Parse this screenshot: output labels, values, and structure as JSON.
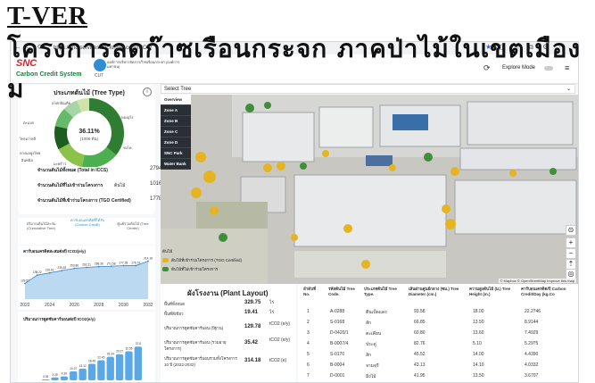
{
  "heading": {
    "title": "T-VER",
    "subtitle_line1": "โครงการลดก๊าซเรือนกระจก ภาคป่าไม้ในเขตเมือง",
    "subtitle_line2": "ม"
  },
  "browser": {
    "url": "https://snc-services.sncformer.com/ICCS/"
  },
  "header": {
    "brand": "SNC",
    "system": "Carbon Credit System",
    "tgo_abbr": "CUT",
    "tgo_text": "องค์การบริหารจัดการก๊าซเรือนกระจก (องค์การมหาชน)",
    "explore_label": "Explore Mode"
  },
  "tree_type_card": {
    "title": "ประเภทต้นไม้ (Tree Type)",
    "center_percent": "36.11%",
    "center_sub": "(1009 ต้น)",
    "slice_labels": [
      "อโศกอินเดีย",
      "ตะแบก",
      "ทองอุไร",
      "ไทรเกาหลี",
      "หางนกยูงไทย",
      "อินทนิล",
      "มะพร้าว",
      "ชงโค"
    ],
    "rows": [
      {
        "label": "จำนวนต้นไม้ทั้งหมด (Total in ICCS)",
        "value": "2794"
      },
      {
        "label": "จำนวนต้นไม้ที่ไม่เข้าร่วมโครงการ",
        "value": "1016"
      },
      {
        "label": "จำนวนต้นไม้ที่เข้าร่วมโครงการ (TGO Certified)",
        "value": "1778"
      }
    ],
    "extra_label": "ต้นไม้"
  },
  "tabs": [
    {
      "label": "ปริมาณต้นไม้สะสม (Cumulative Tree)"
    },
    {
      "label": "คาร์บอนเครดิตที่ได้รับ (Carbon Credit)"
    },
    {
      "label": "ศูนย์รวมต้นไม้ (Tree Center)"
    }
  ],
  "chart_data": [
    {
      "type": "area",
      "title": "คาร์บอนเครดิตสะสมต่อปี  tCO2(e/y)",
      "x": [
        2022,
        2023,
        2024,
        2025,
        2026,
        2027,
        2028,
        2029,
        2030,
        2031,
        2032
      ],
      "x_ticks": [
        "2022",
        "2024",
        "2026",
        "2028",
        "2030",
        "2032"
      ],
      "values": [
        129.57,
        198.22,
        216.62,
        235.52,
        253.86,
        262.21,
        268.36,
        271.58,
        277.38,
        276.74,
        314.18
      ]
    },
    {
      "type": "bar",
      "title": "ปริมาณการดูดซับคาร์บอนต่อปี  tCO2(e/y)",
      "values": [
        0.05,
        3.25,
        4.39,
        10.07,
        13.12,
        18.46,
        22.45,
        26.34,
        29.27,
        32.55,
        37.8
      ]
    }
  ],
  "map": {
    "select_placeholder": "Select Tree",
    "layers": [
      "Overview",
      "Zone A",
      "Zone B",
      "Zone C",
      "Zone D",
      "SNC Park",
      "Water Bank"
    ],
    "legend_title": "ต้นไม้",
    "legend_items": [
      {
        "label": "ต้นไม้ที่เข้าร่วมโครงการ (TGO Certified)",
        "color": "#e6b422"
      },
      {
        "label": "ต้นไม้ที่ไม่เข้าร่วมโครงการ",
        "color": "#3f8f3a"
      }
    ],
    "attribution": "© Mapbox © OpenStreetMap  Improve this map"
  },
  "plant_layout": {
    "title": "ผังโรงงาน (Plant Layout)",
    "rows": [
      {
        "label": "พื้นที่ทั้งหมด",
        "value": "329.75",
        "unit": "ไร่"
      },
      {
        "label": "พื้นที่สีเขียว",
        "value": "19.41",
        "unit": "ไร่"
      },
      {
        "label": "ปริมาณการดูดซับคาร์บอน (ปีฐาน)",
        "value": "129.78",
        "unit": "tCO2 (e/y)"
      },
      {
        "label": "ปริมาณการดูดซับคาร์บอน (รวมอายุโครงการ)",
        "value": "35.42",
        "unit": "tCO2 (e/y)"
      },
      {
        "label": "ปริมาณการดูดซับคาร์บอนรวมทั้งโครงการ 10 ปี (2022-2032)",
        "value": "314.18",
        "unit": "tCO2 (e)"
      }
    ]
  },
  "tree_table": {
    "columns": [
      "ลำดับที่ No.",
      "รหัสต้นไม้ Tree Code.",
      "ประเภทต้นไม้ Tree Type.",
      "เส้นผ่านศูนย์กลาง (ซม.) Tree Diameter (cm.)",
      "ความสูงต้นไม้ (ม.) Tree Height (m.)",
      "คาร์บอนเครดิต/ปี Carbon Credit/Day (kg.Co"
    ],
    "rows": [
      [
        "1",
        "A-0288",
        "ตีนเป็ดแดง",
        "93.58",
        "18.00",
        "22.2746"
      ],
      [
        "2",
        "S-0168",
        "สัก",
        "66.85",
        "13.50",
        "8.9144"
      ],
      [
        "3",
        "D-0420/1",
        "ตะเคียน",
        "60.80",
        "13.60",
        "7.4929"
      ],
      [
        "4",
        "B-0007/4",
        "ประดู่",
        "82.76",
        "5.10",
        "5.2975"
      ],
      [
        "5",
        "S-0170",
        "สัก",
        "45.52",
        "14.00",
        "4.4390"
      ],
      [
        "6",
        "B-0004",
        "จามจุรี",
        "43.13",
        "14.10",
        "4.0332"
      ],
      [
        "7",
        "D-0001",
        "มิ่งไม้",
        "41.95",
        "13.50",
        "3.6707"
      ]
    ]
  }
}
